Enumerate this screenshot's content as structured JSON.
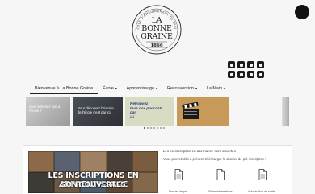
{
  "logo": {
    "arc_text": "ÉCOLE D'AMEUBLEMENT DE PARIS",
    "line1": "LA",
    "line2": "BONNE",
    "line3": "GRAINE",
    "year": "1866"
  },
  "social_icons": [
    [
      "linkedin-icon",
      "instagram-icon",
      "youtube-icon",
      "twitter-icon"
    ],
    [
      "pinterest-icon",
      "vimeo-icon",
      "mail-icon",
      "facebook-icon"
    ]
  ],
  "nav": {
    "items": [
      {
        "label": "Bienvenue à La Bonne Graine",
        "has_caret": false
      },
      {
        "label": "École",
        "has_caret": true
      },
      {
        "label": "Apprentissage",
        "has_caret": true
      },
      {
        "label": "Reconversion",
        "has_caret": true
      },
      {
        "label": "La Main",
        "has_caret": true
      }
    ],
    "caret": "▾"
  },
  "carousel": {
    "slide1_line1": "vous aimeriez voir à",
    "slide1_line2": "l'école ?",
    "slide2_line1": "Pour découvrir l'histoire",
    "slide2_line2": "de l'école c'est par ici",
    "slide3_line1": "Retrouvez",
    "slide3_line2": "tous nos podcasts",
    "slide3_line3": "par",
    "slide3_line4": "ici"
  },
  "dots": {
    "count": 7,
    "active": 0
  },
  "banner": {
    "line1": "LES INSCRIPTIONS EN APPRENTISSAGE",
    "line2": "SONT OUVERTES"
  },
  "info": {
    "line1": "Les préinscription en alternance sont ouvertes !",
    "line2": "Vous pouvez dès à présent télécharger le dossier de pré-inscription :"
  },
  "documents": [
    {
      "label": "Dossier de pré-"
    },
    {
      "label": "Fiche informations"
    },
    {
      "label": "Autorisation de sortie -"
    }
  ]
}
